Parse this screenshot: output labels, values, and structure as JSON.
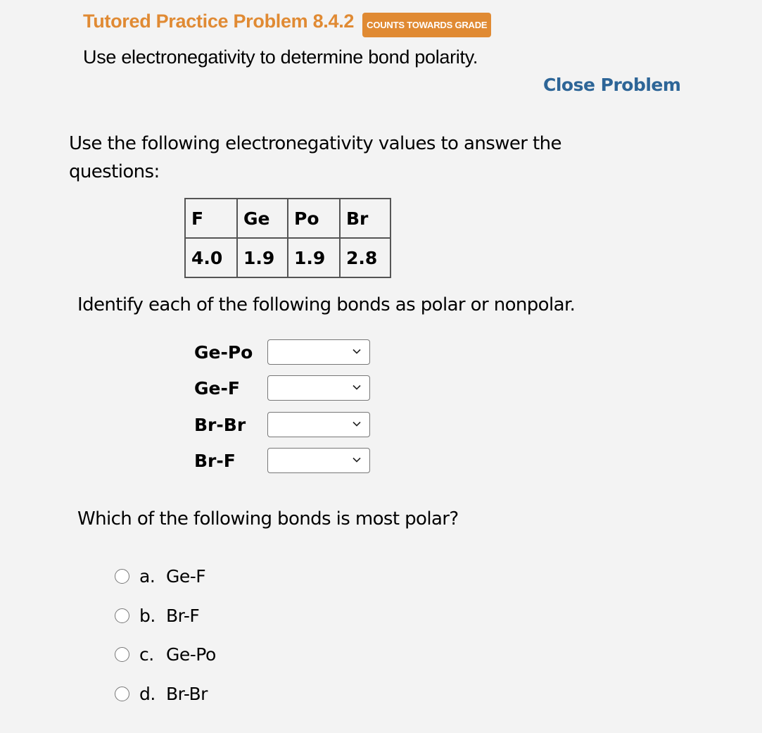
{
  "header": {
    "title": "Tutored Practice Problem 8.4.2",
    "badge": "COUNTS TOWARDS GRADE",
    "subtitle": "Use electronegativity to determine bond polarity.",
    "close_label": "Close Problem"
  },
  "colors": {
    "accent_orange": "#e08a33",
    "link_blue": "#2d6597",
    "background": "#f3f3f3"
  },
  "intro": "Use the following electronegativity values to answer the questions:",
  "table": {
    "headers": [
      "F",
      "Ge",
      "Po",
      "Br"
    ],
    "values": [
      "4.0",
      "1.9",
      "1.9",
      "2.8"
    ]
  },
  "question1": {
    "prompt": "Identify each of the following bonds as polar or nonpolar.",
    "bonds": [
      {
        "label": "Ge-Po",
        "selected": ""
      },
      {
        "label": "Ge-F",
        "selected": ""
      },
      {
        "label": "Br-Br",
        "selected": ""
      },
      {
        "label": "Br-F",
        "selected": ""
      }
    ]
  },
  "question2": {
    "prompt": "Which of the following bonds is most polar?",
    "options": [
      {
        "letter": "a.",
        "label": "Ge-F"
      },
      {
        "letter": "b.",
        "label": "Br-F"
      },
      {
        "letter": "c.",
        "label": "Ge-Po"
      },
      {
        "letter": "d.",
        "label": "Br-Br"
      }
    ]
  }
}
